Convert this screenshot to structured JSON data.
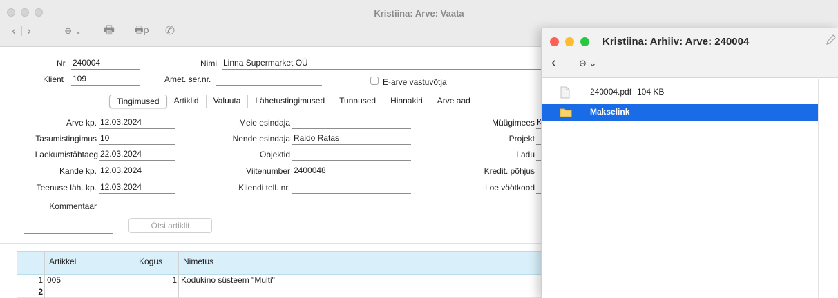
{
  "main": {
    "title": "Kristiina: Arve: Vaata",
    "toolbar": {
      "back": "‹",
      "forward": "›",
      "more": "⊖ ⌄",
      "print": "🖶",
      "preview": "🖶ρ",
      "phone": "✆"
    },
    "header": {
      "nr_label": "Nr.",
      "nr_value": "240004",
      "nimi_label": "Nimi",
      "nimi_value": "Linna Supermarket OÜ",
      "klient_label": "Klient",
      "klient_value": "109",
      "amet_label": "Amet. ser.nr.",
      "amet_value": "",
      "earve_label": "E-arve vastuvõtja"
    },
    "tabs": [
      {
        "label": "Tingimused"
      },
      {
        "label": "Artiklid"
      },
      {
        "label": "Valuuta"
      },
      {
        "label": "Lähetustingimused"
      },
      {
        "label": "Tunnused"
      },
      {
        "label": "Hinnakiri"
      },
      {
        "label": "Arve aad"
      }
    ],
    "form": {
      "arve_kp_label": "Arve kp.",
      "arve_kp_value": "12.03.2024",
      "tasumistingimus_label": "Tasumistingimus",
      "tasumistingimus_value": "10",
      "laekumistahtaeg_label": "Laekumistähtaeg",
      "laekumistahtaeg_value": "22.03.2024",
      "kande_kp_label": "Kande kp.",
      "kande_kp_value": "12.03.2024",
      "teenuse_lah_label": "Teenuse läh. kp.",
      "teenuse_lah_value": "12.03.2024",
      "meie_esindaja_label": "Meie esindaja",
      "meie_esindaja_value": "",
      "nende_esindaja_label": "Nende esindaja",
      "nende_esindaja_value": "Raido Ratas",
      "objektid_label": "Objektid",
      "objektid_value": "",
      "viitenumber_label": "Viitenumber",
      "viitenumber_value": "2400048",
      "kliendi_tell_label": "Kliendi tell. nr.",
      "kliendi_tell_value": "",
      "myygimees_label": "Müügimees",
      "myygimees_value": "K",
      "projekt_label": "Projekt",
      "ladu_label": "Ladu",
      "kredit_label": "Kredit. põhjus",
      "loe_label": "Loe vöötkood",
      "kommentaar_label": "Kommentaar",
      "kommentaar_value": ""
    },
    "search_button": "Otsi artiklit",
    "grid": {
      "columns": [
        "Artikkel",
        "Kogus",
        "Nimetus"
      ],
      "rows": [
        {
          "num": "1",
          "artikkel": "005",
          "kogus": "1",
          "nimetus": "Kodukino süsteem \"Multi\""
        },
        {
          "num": "2",
          "artikkel": "",
          "kogus": "",
          "nimetus": ""
        }
      ]
    }
  },
  "archive": {
    "title": "Kristiina: Arhiiv: Arve: 240004",
    "back": "‹",
    "more": "⊖ ⌄",
    "items": [
      {
        "name": "240004.pdf",
        "size": "104 KB",
        "icon": "document-icon"
      },
      {
        "name": "Makselink",
        "size": "",
        "icon": "folder-icon"
      }
    ],
    "colors": {
      "selection": "#1a6ce6",
      "close": "#fe5f57",
      "minimize": "#febc2e",
      "zoom": "#28c840"
    }
  }
}
